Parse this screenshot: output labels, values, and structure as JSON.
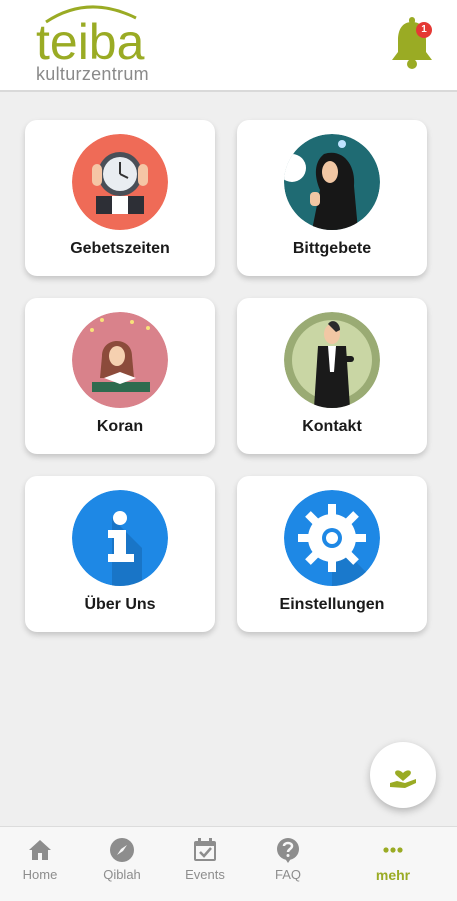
{
  "header": {
    "logo_main": "teiba",
    "logo_sub": "kulturzentrum",
    "notification_count": "1"
  },
  "tiles": [
    {
      "label": "Gebetszeiten",
      "icon": "alarm-clock-icon"
    },
    {
      "label": "Bittgebete",
      "icon": "praying-woman-icon"
    },
    {
      "label": "Koran",
      "icon": "reading-quran-icon"
    },
    {
      "label": "Kontakt",
      "icon": "contact-person-icon"
    },
    {
      "label": "Über Uns",
      "icon": "info-icon"
    },
    {
      "label": "Einstellungen",
      "icon": "gear-icon"
    }
  ],
  "fab": {
    "icon": "donate-heart-hand-icon"
  },
  "bottom_nav": [
    {
      "label": "Home",
      "icon": "home-icon"
    },
    {
      "label": "Qiblah",
      "icon": "compass-icon"
    },
    {
      "label": "Events",
      "icon": "calendar-icon"
    },
    {
      "label": "FAQ",
      "icon": "question-icon"
    },
    {
      "label": "mehr",
      "icon": "more-dots-icon",
      "active": true
    }
  ],
  "colors": {
    "brand": "#9aab24",
    "inactive": "#8d8d8d",
    "badge": "#e53935",
    "info_blue": "#1e88e5"
  }
}
